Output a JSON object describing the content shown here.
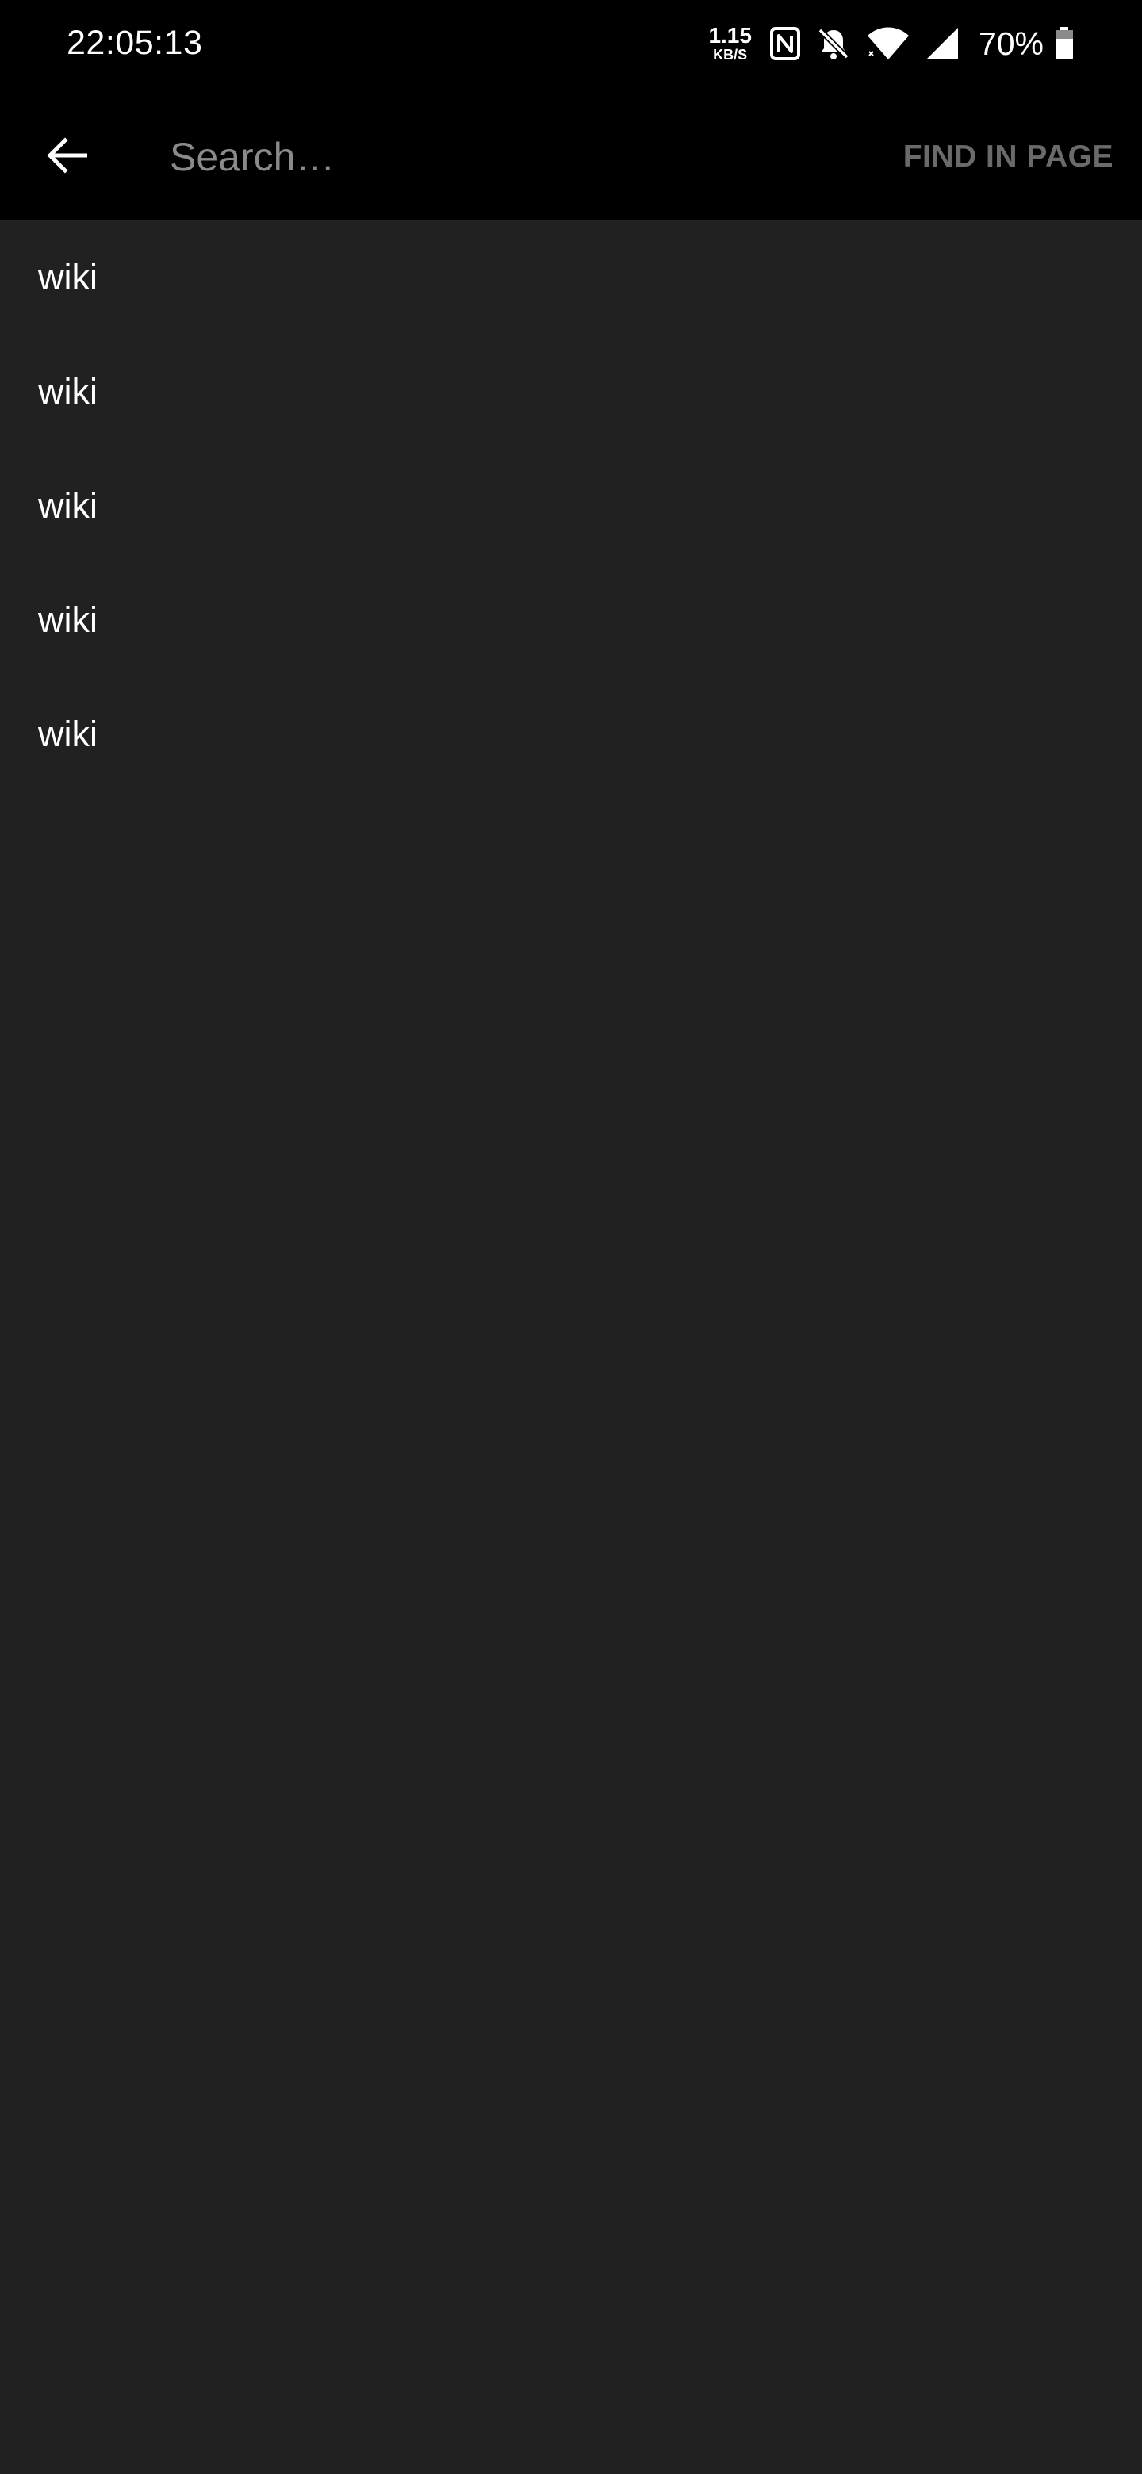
{
  "status_bar": {
    "time": "22:05:13",
    "net_speed_value": "1.15",
    "net_speed_unit": "KB/S",
    "icons": [
      "nfc-icon",
      "bell-off-icon",
      "wifi-icon",
      "signal-icon",
      "battery-icon"
    ],
    "battery_percent": "70%"
  },
  "toolbar": {
    "back_icon": "arrow-left-icon",
    "search_placeholder": "Search…",
    "search_value": "",
    "find_in_page_label": "FIND IN PAGE"
  },
  "results": [
    {
      "label": "wiki"
    },
    {
      "label": "wiki"
    },
    {
      "label": "wiki"
    },
    {
      "label": "wiki"
    },
    {
      "label": "wiki"
    }
  ],
  "colors": {
    "background": "#212121",
    "toolbar": "#000000",
    "text": "#ffffff",
    "placeholder": "#8a8a8a",
    "find_button": "#6a6a6a"
  }
}
